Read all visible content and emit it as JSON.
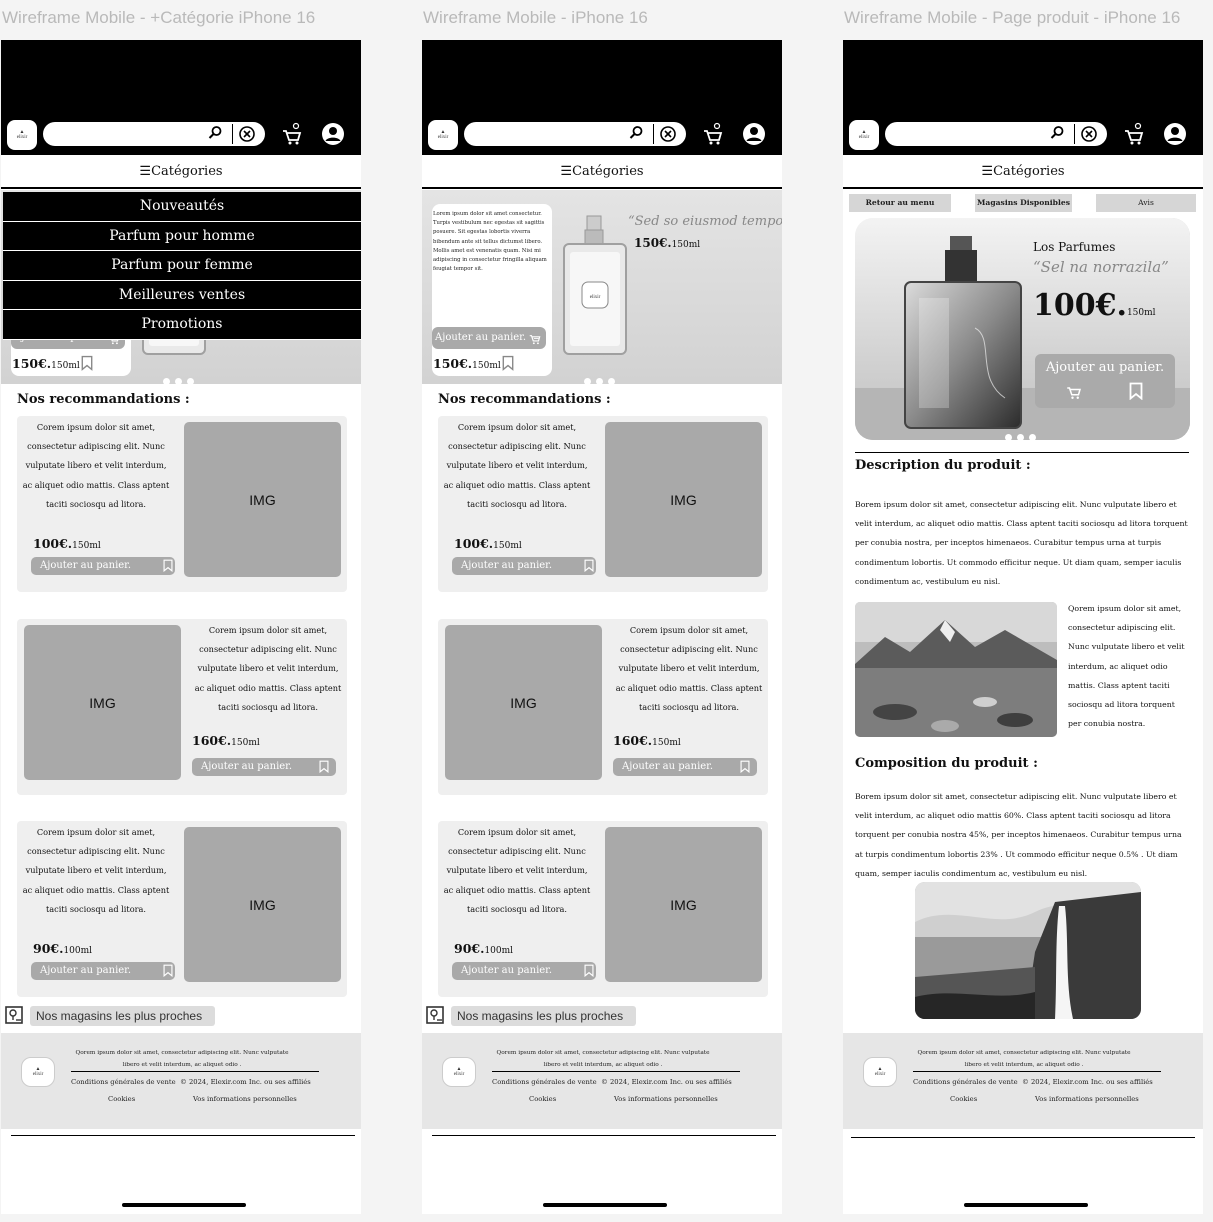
{
  "frames": [
    {
      "title": "Wireframe Mobile - +Catégorie iPhone 16"
    },
    {
      "title": "Wireframe Mobile - iPhone 16"
    },
    {
      "title": "Wireframe Mobile - Page produit - iPhone 16"
    }
  ],
  "header": {
    "logo_text": "elixir",
    "categories_label": "☰Catégories"
  },
  "menu": {
    "items": [
      "Nouveautés",
      "Parfum pour homme",
      "Parfum pour femme",
      "Meilleures ventes",
      "Promotions"
    ]
  },
  "hero": {
    "text": "Lorem ipsum dolor sit amet consectetur. Turpis vestibulum nec egestas sit sagittis posuere. Sit egestas lobortis viverra bibendum ante sit tellus dictumst libero. Mollis amet est venenatis quam. Nisi mi adipiscing in consectetur fringilla aliquam feugiat tempor sit.",
    "add_label": "Ajouter au panier.",
    "price": "150€.",
    "volume": "150ml",
    "script": "“Sed so eiusmod tempor”",
    "price2": "150€.",
    "volume2": "150ml"
  },
  "recommendations": {
    "title": "Nos recommandations :",
    "img_label": "IMG",
    "items": [
      {
        "text": "Corem ipsum dolor sit amet, consectetur adipiscing elit. Nunc vulputate libero et velit interdum, ac aliquet odio mattis. Class aptent taciti sociosqu ad litora.",
        "price": "100€.",
        "volume": "150ml",
        "add_label": "Ajouter au panier."
      },
      {
        "text": "Corem ipsum dolor sit amet, consectetur adipiscing elit. Nunc vulputate libero et velit interdum, ac aliquet odio mattis. Class aptent taciti sociosqu ad litora.",
        "price": "160€.",
        "volume": "150ml",
        "add_label": "Ajouter au panier."
      },
      {
        "text": "Corem ipsum dolor sit amet, consectetur adipiscing elit. Nunc vulputate libero et velit interdum, ac aliquet odio mattis. Class aptent taciti sociosqu ad litora.",
        "price": "90€.",
        "volume": "100ml",
        "add_label": "Ajouter au panier."
      }
    ]
  },
  "stores": {
    "label": "Nos magasins les plus proches"
  },
  "footer": {
    "text": "Qorem ipsum dolor sit amet, consectetur adipiscing elit. Nunc vulputate libero et velit interdum, ac aliquet odio .",
    "terms": "Conditions générales de vente",
    "copyright": "© 2024, Elexir.com Inc. ou ses affiliés",
    "cookies": "Cookies",
    "personal": "Vos informations personnelles"
  },
  "product": {
    "tabs": [
      "Retour au menu",
      "Magasins Disponibles",
      "Avis"
    ],
    "brand": "Los Parfumes",
    "script": "“Sel na norrazila”",
    "price": "100€.",
    "volume": "150ml",
    "add_label": "Ajouter au panier.",
    "desc_title": "Description du produit :",
    "desc_text": "Borem ipsum dolor sit amet, consectetur adipiscing elit. Nunc vulputate libero et velit interdum, ac aliquet odio mattis. Class aptent taciti sociosqu ad litora torquent per conubia nostra, per inceptos himenaeos. Curabitur tempus urna at turpis condimentum lobortis. Ut commodo efficitur neque. Ut diam quam, semper iaculis condimentum ac, vestibulum eu nisl.",
    "side_text": "Qorem ipsum dolor sit amet, consectetur adipiscing elit. Nunc vulputate libero et velit interdum, ac aliquet odio mattis. Class aptent taciti sociosqu ad litora torquent per conubia nostra.",
    "comp_title": "Composition du produit :",
    "comp_text": "Borem ipsum dolor sit amet, consectetur adipiscing elit. Nunc vulputate libero et velit interdum, ac aliquet odio mattis 60%. Class aptent taciti sociosqu ad litora torquent per conubia nostra 45%, per inceptos himenaeos. Curabitur tempus urna at turpis condimentum lobortis 23% . Ut commodo efficitur neque 0.5% . Ut diam quam, semper iaculis condimentum ac, vestibulum eu nisl."
  },
  "colors": {
    "black": "#000000",
    "gray": "#a9a9a9",
    "card_bg": "#efefef",
    "footer_bg": "#e6e6e6"
  }
}
